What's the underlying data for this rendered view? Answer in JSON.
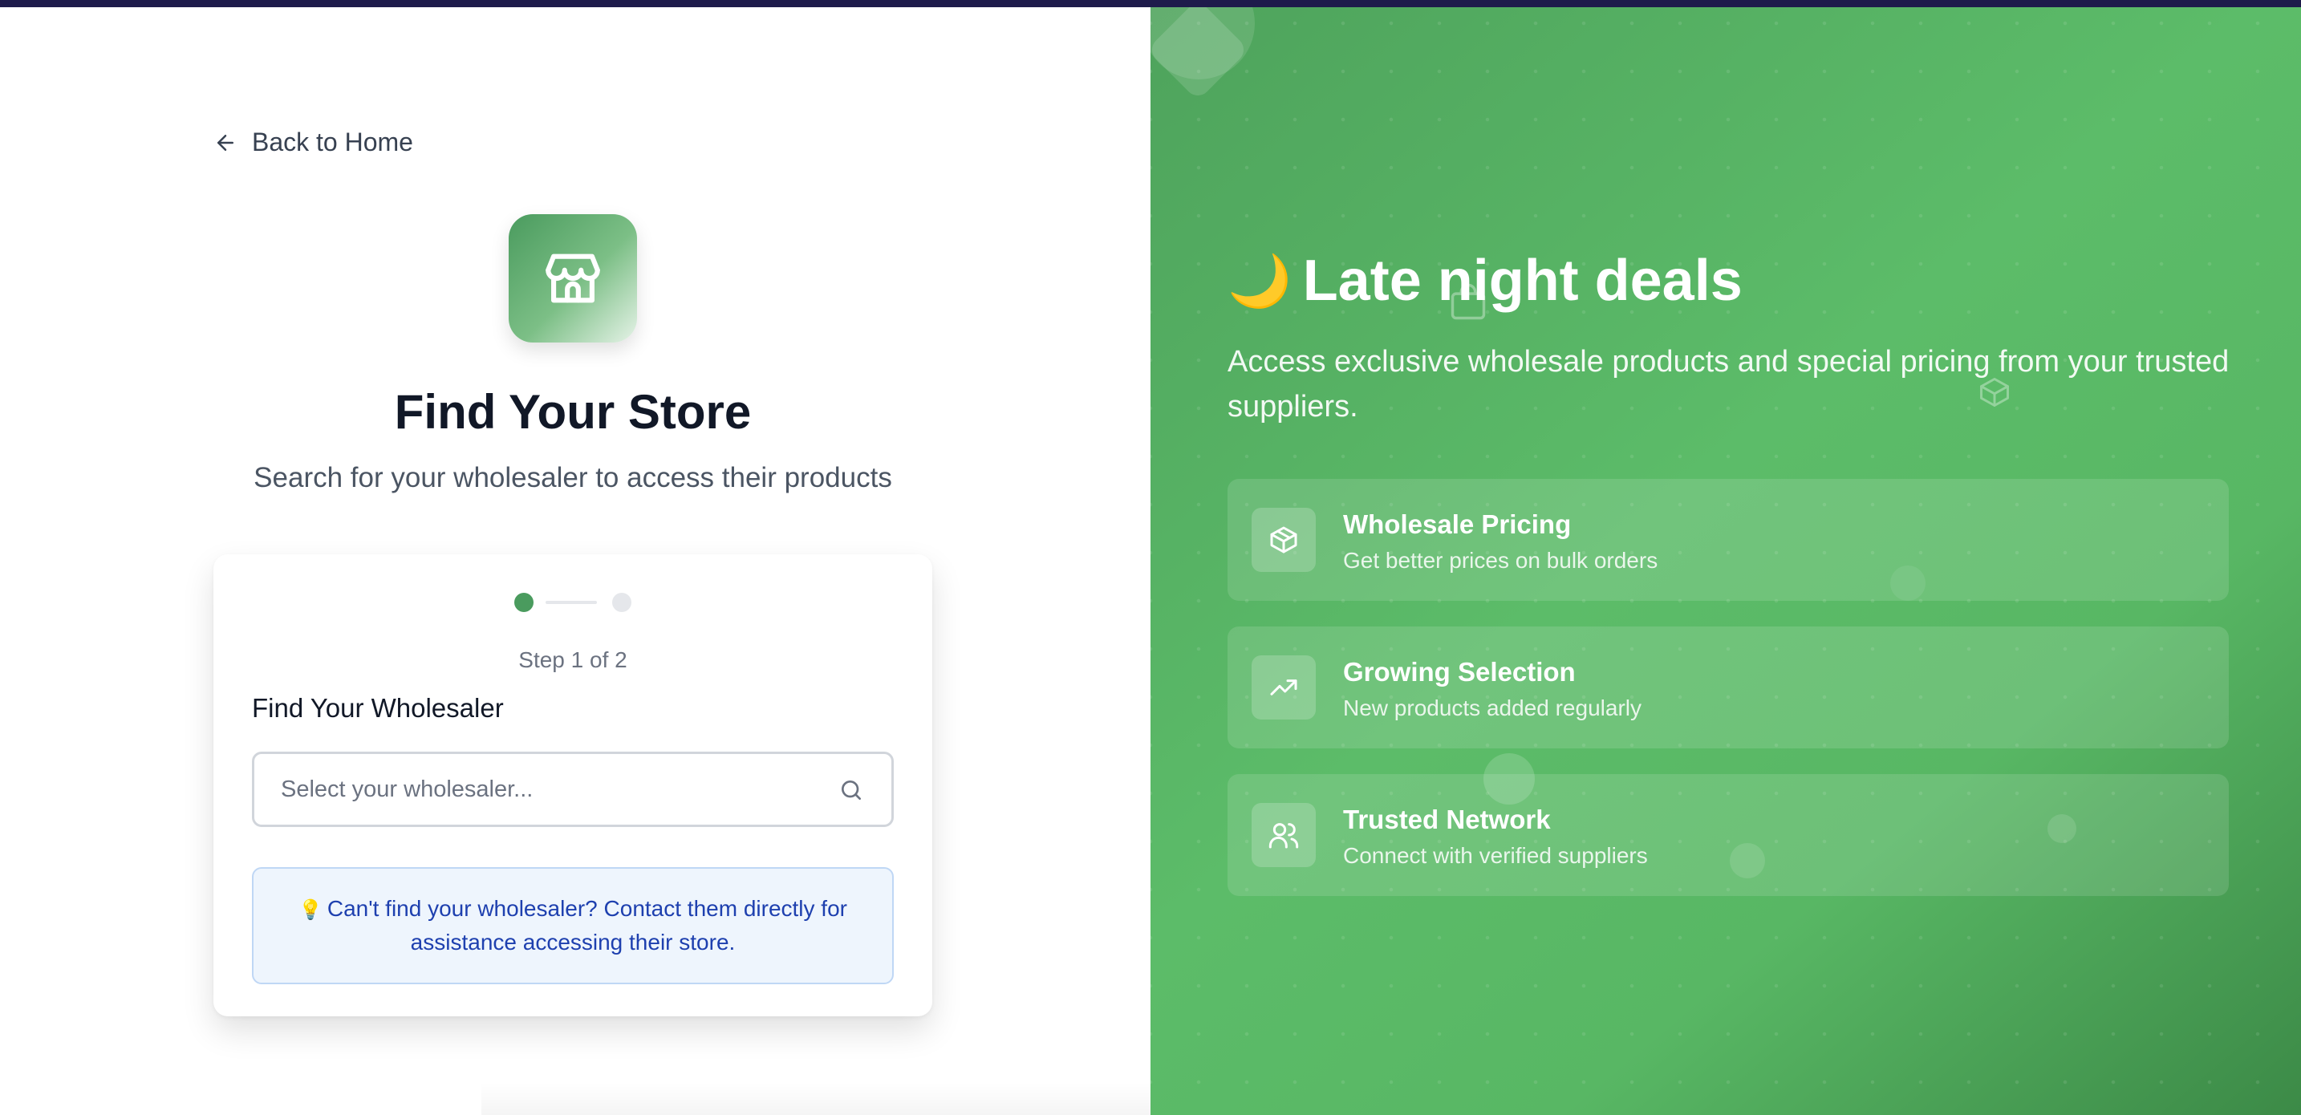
{
  "nav": {
    "back_label": "Back to Home"
  },
  "header": {
    "title": "Find Your Store",
    "subtitle": "Search for your wholesaler to access their products"
  },
  "steps": {
    "current": 1,
    "total": 2,
    "label": "Step 1 of 2"
  },
  "form": {
    "label": "Find Your Wholesaler",
    "search_placeholder": "Select your wholesaler...",
    "search_value": ""
  },
  "info": {
    "icon": "💡",
    "text": "Can't find your wholesaler? Contact them directly for assistance accessing their store."
  },
  "promo": {
    "icon": "🌙",
    "title": "Late night deals",
    "description": "Access exclusive wholesale products and special pricing from your trusted suppliers.",
    "features": [
      {
        "icon": "package-icon",
        "title": "Wholesale Pricing",
        "description": "Get better prices on bulk orders"
      },
      {
        "icon": "trending-up-icon",
        "title": "Growing Selection",
        "description": "New products added regularly"
      },
      {
        "icon": "users-icon",
        "title": "Trusted Network",
        "description": "Connect with verified suppliers"
      }
    ]
  },
  "colors": {
    "accent_green": "#4a9b5e",
    "promo_gradient_start": "#4ea35c",
    "promo_gradient_end": "#3c8a47",
    "info_text": "#1e40af",
    "info_background": "#eef5fd",
    "top_strip": "#1e1b4b"
  }
}
